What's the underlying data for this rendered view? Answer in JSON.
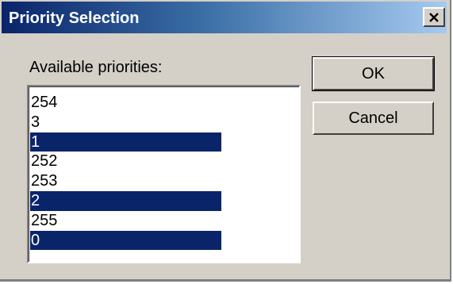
{
  "window": {
    "title": "Priority Selection",
    "close_icon": "close-icon"
  },
  "list": {
    "label": "Available priorities:",
    "items": [
      {
        "text": "254",
        "selected": false
      },
      {
        "text": "3",
        "selected": false
      },
      {
        "text": "1",
        "selected": true
      },
      {
        "text": "252",
        "selected": false
      },
      {
        "text": "253",
        "selected": false
      },
      {
        "text": "2",
        "selected": true
      },
      {
        "text": "255",
        "selected": false
      },
      {
        "text": "0",
        "selected": true
      }
    ]
  },
  "buttons": {
    "ok_label": "OK",
    "cancel_label": "Cancel"
  },
  "colors": {
    "title_start": "#0a246a",
    "title_end": "#a6caf0",
    "selection": "#0a246a",
    "face": "#d4d0c8"
  }
}
